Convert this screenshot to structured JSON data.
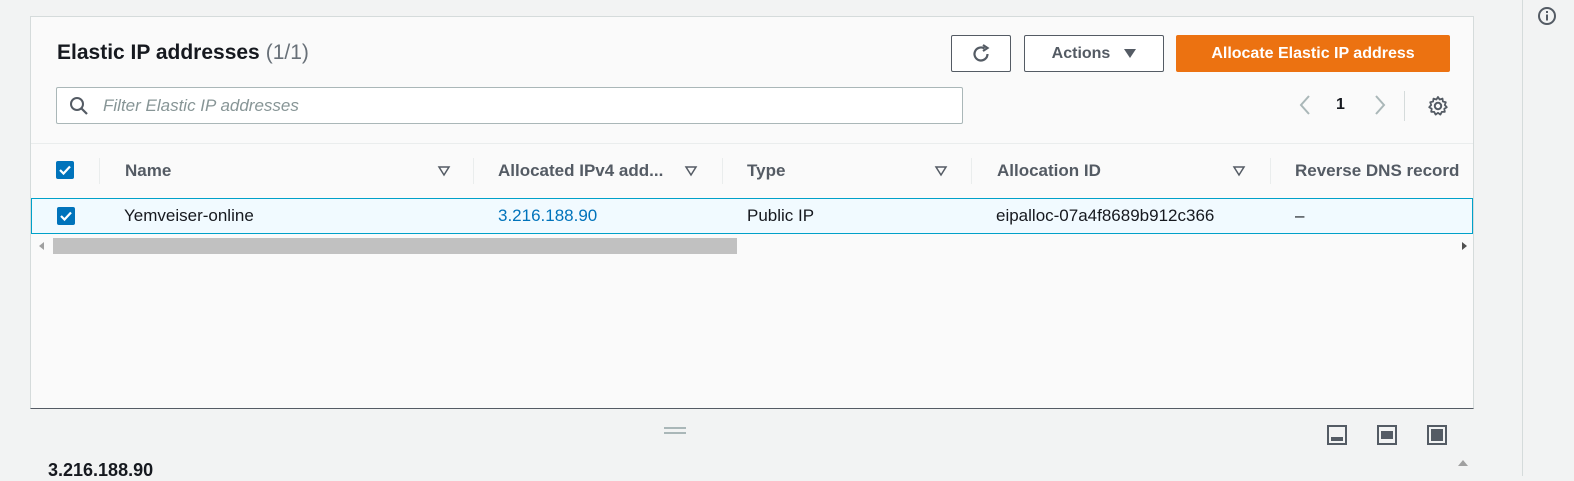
{
  "header": {
    "title": "Elastic IP addresses",
    "count": "(1/1)",
    "refresh_icon": "refresh-icon",
    "actions_label": "Actions",
    "allocate_label": "Allocate Elastic IP address"
  },
  "search": {
    "placeholder": "Filter Elastic IP addresses",
    "value": ""
  },
  "pagination": {
    "current_page": "1"
  },
  "table": {
    "columns": [
      "Name",
      "Allocated IPv4 add...",
      "Type",
      "Allocation ID",
      "Reverse DNS record"
    ],
    "rows": [
      {
        "selected": true,
        "name": "Yemveiser-online",
        "ipv4": "3.216.188.90",
        "type": "Public IP",
        "allocation_id": "eipalloc-07a4f8689b912c366",
        "reverse_dns": "–"
      }
    ]
  },
  "details": {
    "title": "3.216.188.90"
  },
  "colors": {
    "accent": "#ec7211",
    "link": "#0073bb",
    "selected_row": "#f1faff",
    "selected_border": "#00a1c9"
  }
}
